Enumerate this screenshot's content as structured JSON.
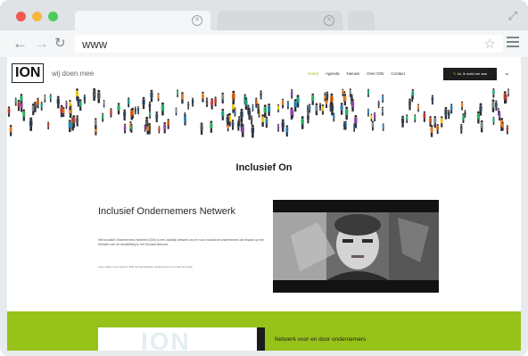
{
  "browser": {
    "url": "www",
    "icons": {
      "back": "arrow-left-icon",
      "forward": "arrow-right-icon",
      "reload": "reload-icon",
      "bookmark": "star-icon",
      "menu": "hamburger-menu-icon",
      "expand": "expand-icon",
      "tab_close": "close-icon"
    }
  },
  "site": {
    "logo": "ION",
    "tagline": "wij doen mee",
    "menu": [
      "Home",
      "Agenda",
      "Nieuws",
      "Over ION",
      "Contact"
    ],
    "cta": "Ja, ik meld me aan",
    "section_title": "Inclusief On",
    "ion_heading": "Inclusief Ondernemers Netwerk",
    "ion_para": "Het Inclusief Ondernemers Netwerk (ION) is een zakelijk netwerk van en voor inclusieve ondernemers die impact op het behalen van de doelstelling in het Sociaal Akkoord.",
    "ion_link": "Lees verder over waarom ION de belangrijkste ondernemers en ondernemende.",
    "band_text": "Netwerk voor en door ondernemers",
    "card_logo": "ION"
  },
  "colors": {
    "accent_green": "#97c21a",
    "dark": "#1e1e1e"
  }
}
